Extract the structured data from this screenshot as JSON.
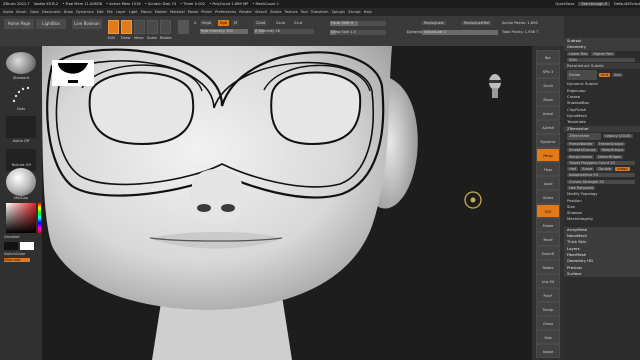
{
  "titlebar": {
    "app": "ZBrush 2021.7",
    "doc": "Voxkie K9 B-2",
    "free_mem": "• Free Mem 11.006GB",
    "active_mem": "• Active Mem 1516",
    "scratch": "• Scratch Disk 74",
    "timer": "• Timer 0.002",
    "polycount": "• PolyCount 1.869 MP",
    "meshcount": "• MeshCount 1",
    "quicksave": "QuickSave",
    "see_through": "See-through 0",
    "script": "DefaultZScript"
  },
  "menu": [
    "Alpha",
    "Brush",
    "Color",
    "Document",
    "Draw",
    "Dynamics",
    "Edit",
    "File",
    "Layer",
    "Light",
    "Macro",
    "Marker",
    "Material",
    "Movie",
    "Picker",
    "Preferences",
    "Render",
    "Stencil",
    "Stroke",
    "Texture",
    "Tool",
    "Transform",
    "Zplugin",
    "Zscript",
    "Help"
  ],
  "toolbar": {
    "home_page": "Home Page",
    "lightbox": "LightBox",
    "live_boolean": "Live Boolean",
    "edit": "Edit",
    "draw": "Draw",
    "move": "Move",
    "scale": "Scale",
    "rotate": "Rotate",
    "a_label": "A",
    "mrgb": "Mrgb",
    "rgb": "Rgb",
    "m": "M",
    "zadd": "Zadd",
    "zsub": "Zsub",
    "zcut": "Zcut",
    "rgb_intensity": "Rgb Intensity 100",
    "z_intensity": "Z Intensity 16",
    "focal_shift": "Focal Shift 0",
    "draw_size": "Draw Size 1.5",
    "dynamic": "Dynamic",
    "replay_last": "ReplayLast",
    "replay_last_rel": "ReplayLastRel",
    "adjust_last": "AdjustLast 1",
    "active_points": "Active Points: 1.856",
    "total_points": "Total Points: 1.938 T"
  },
  "left_shelf": {
    "standard": "Standard",
    "dots": "Dots",
    "alpha_off": "Alpha Off",
    "texture_off": "Texture Off",
    "matcap": "MatCap",
    "gradient": "Gradient",
    "switch_color": "SwitchColor",
    "alternate": "Alternate"
  },
  "right_shelf": [
    "Bpr",
    "SPix 3",
    "Scroll",
    "Zoom",
    "Actual",
    "AAHalf",
    "Dynamic",
    "Persp",
    "Floor",
    "Local",
    "Gizmo",
    "XYZ",
    "Frame",
    "Move",
    "ZoomD",
    "Rotate",
    "Line Fill",
    "PolyF",
    "Transp",
    "Ghost",
    "Solo",
    "Xpose"
  ],
  "right_panel": {
    "subtool": "Subtool",
    "geometry": "Geometry",
    "lower_res": "Lower Res",
    "higher_res": "Higher Res",
    "sdiv": "SDiv",
    "reconstruct_subdiv": "Reconstruct Subdiv",
    "divide": "Divide",
    "smt": "Smt",
    "suv": "Suv",
    "items": [
      "Dynamic Subdiv",
      "EdgeLoop",
      "Crease",
      "ShadowBox",
      "ClayPolish",
      "DynaMesh",
      "Tessimate"
    ],
    "zremesher": "ZRemesher",
    "zremesher_btn": "ZRemesher",
    "legacy": "Legacy (2018)",
    "freeze_border": "FreezeBorder",
    "freeze_groups": "FreezeGroups",
    "smooth_groups": "SmoothGroups",
    "keep_groups": "KeepGroups",
    "keep_creases": "KeepCreases",
    "detect_edges": "DetectEdges",
    "target_polygons": "Target Polygons Count 20",
    "half": "Half",
    "same": "Same",
    "double": "Double",
    "adapt": "Adapt",
    "adaptive_size": "AdaptiveSize 50",
    "curves_strength": "Curves Strength 50",
    "use_polypaint": "Use Polypaint",
    "more": [
      "Modify Topology",
      "Position",
      "Size",
      "Shadow",
      "MeshIntegrity"
    ],
    "bottom": [
      "ArrayMesh",
      "NanoMesh",
      "Thick Skin",
      "Layers",
      "FiberMesh",
      "Geometry HD",
      "Preview",
      "Surface"
    ]
  },
  "colors": {
    "accent": "#e07a1a",
    "panel": "#2c2c2c",
    "canvas_bg": "#1d1d1d"
  }
}
